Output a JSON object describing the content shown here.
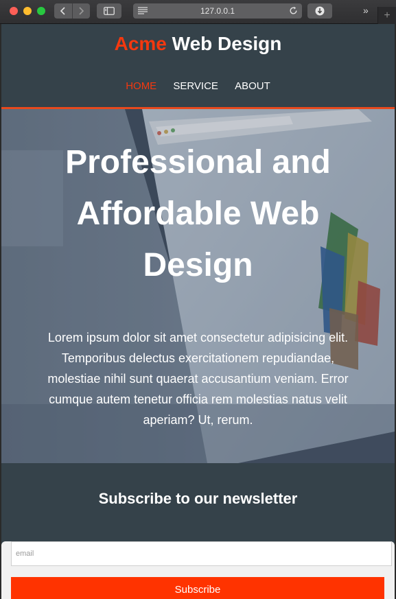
{
  "browser": {
    "url": "127.0.0.1",
    "icons": {
      "close": "traffic-light-red",
      "minimize": "traffic-light-yellow",
      "zoom": "traffic-light-green",
      "back": "chevron-left-icon",
      "forward": "chevron-right-icon",
      "sidebar": "sidebar-icon",
      "reader": "reader-icon",
      "reload": "reload-icon",
      "download": "download-icon",
      "overflow": "double-chevron-icon",
      "new_tab": "plus-icon"
    },
    "overflow_glyph": "»",
    "new_tab_glyph": "+"
  },
  "header": {
    "brand_highlight": "Acme",
    "brand_rest": " Web Design",
    "nav": [
      {
        "label": "HOME",
        "current": true
      },
      {
        "label": "SERVICE",
        "current": false
      },
      {
        "label": "ABOUT",
        "current": false
      }
    ]
  },
  "hero": {
    "title": "Professional and Affordable Web Design",
    "text": "Lorem ipsum dolor sit amet consectetur adipisicing elit. Temporibus delectus exercitationem repudiandae, molestiae nihil sunt quaerat accusantium veniam. Error cumque autem tenetur officia rem molestias natus velit aperiam? Ut, rerum."
  },
  "newsletter": {
    "heading": "Subscribe to our newsletter",
    "email_placeholder": "email",
    "email_value": "",
    "button_label": "Subscribe"
  },
  "colors": {
    "header_bg": "#35424a",
    "accent": "#e8491d",
    "brand_highlight": "#f4380f",
    "button_bg": "#ff3300",
    "page_bg": "#f1f1f1"
  }
}
